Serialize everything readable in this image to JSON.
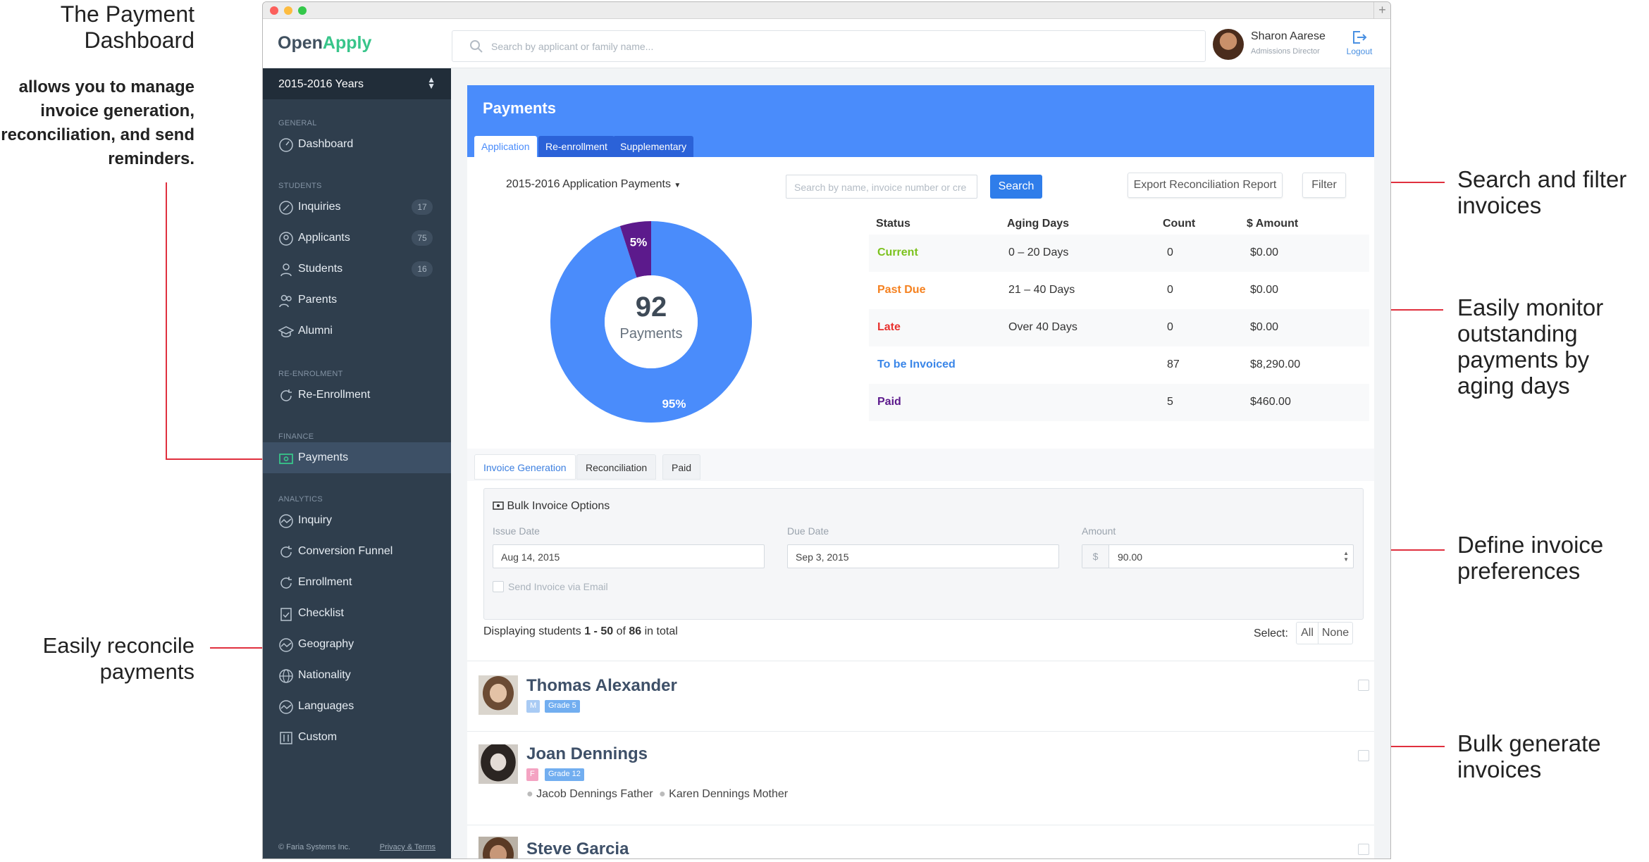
{
  "annotations": {
    "title": "The Payment Dashboard",
    "description": "allows you to manage invoice generation, reconciliation, and send reminders.",
    "search_filter": "Search and filter invoices",
    "monitor": "Easily monitor outstanding payments by aging days",
    "define": "Define invoice preferences",
    "reconcile": "Easily reconcile payments",
    "bulk": "Bulk generate invoices"
  },
  "app": {
    "logo_open": "Open",
    "logo_apply": "Apply",
    "search_placeholder": "Search by applicant or family name...",
    "user_name": "Sharon Aarese",
    "user_role": "Admissions Director",
    "logout": "Logout"
  },
  "sidebar": {
    "year": "2015-2016 Years",
    "sections": {
      "general": "GENERAL",
      "students": "STUDENTS",
      "reenrolment": "RE-ENROLMENT",
      "finance": "FINANCE",
      "analytics": "ANALYTICS"
    },
    "items": {
      "dashboard": "Dashboard",
      "inquiries": "Inquiries",
      "inquiries_count": "17",
      "applicants": "Applicants",
      "applicants_count": "75",
      "students": "Students",
      "students_count": "16",
      "parents": "Parents",
      "alumni": "Alumni",
      "reenrollment": "Re-Enrollment",
      "payments": "Payments",
      "inquiry": "Inquiry",
      "conversion_funnel": "Conversion Funnel",
      "enrollment": "Enrollment",
      "checklist": "Checklist",
      "geography": "Geography",
      "nationality": "Nationality",
      "languages": "Languages",
      "custom": "Custom"
    },
    "footer_company": "© Faria Systems Inc.",
    "footer_link": "Privacy & Terms"
  },
  "payments": {
    "title": "Payments",
    "tabs": [
      "Application",
      "Re-enrollment",
      "Supplementary"
    ],
    "dropdown": "2015-2016 Application Payments",
    "search_placeholder": "Search by name, invoice number or cre",
    "search_button": "Search",
    "export_button": "Export Reconciliation Report",
    "filter_button": "Filter",
    "donut_count": "92",
    "donut_label": "Payments",
    "donut_small_label": "5%",
    "donut_large_label": "95%",
    "donut_fraction_paid": 0.05,
    "table_headers": [
      "Status",
      "Aging Days",
      "Count",
      "$ Amount"
    ],
    "rows": [
      {
        "status": "Current",
        "aging": "0 – 20 Days",
        "count": "0",
        "amount": "$0.00",
        "color": "#7cc21e"
      },
      {
        "status": "Past Due",
        "aging": "21 – 40 Days",
        "count": "0",
        "amount": "$0.00",
        "color": "#f5811f"
      },
      {
        "status": "Late",
        "aging": "Over 40 Days",
        "count": "0",
        "amount": "$0.00",
        "color": "#e8322f"
      },
      {
        "status": "To be Invoiced",
        "aging": "",
        "count": "87",
        "amount": "$8,290.00",
        "color": "#3a86e8"
      },
      {
        "status": "Paid",
        "aging": "",
        "count": "5",
        "amount": "$460.00",
        "color": "#5c1a8c"
      }
    ],
    "subtabs": [
      "Invoice Generation",
      "Reconciliation",
      "Paid"
    ],
    "bulk_title": "Bulk Invoice Options",
    "issue_date_label": "Issue Date",
    "issue_date": "Aug 14, 2015",
    "due_date_label": "Due Date",
    "due_date": "Sep 3, 2015",
    "amount_label": "Amount",
    "amount_prefix": "$",
    "amount": "90.00",
    "send_email": "Send Invoice via Email",
    "display_prefix": "Displaying students",
    "display_range": "1 - 50",
    "display_of": "of",
    "display_total": "86",
    "display_suffix": "in total",
    "select_label": "Select:",
    "select_all": "All",
    "select_none": "None"
  },
  "students": [
    {
      "name": "Thomas Alexander",
      "gender": "M",
      "grade": "Grade 5",
      "family": []
    },
    {
      "name": "Joan Dennings",
      "gender": "F",
      "grade": "Grade 12",
      "family": [
        "Jacob Dennings Father",
        "Karen Dennings Mother"
      ]
    },
    {
      "name": "Steve Garcia",
      "gender": "",
      "grade": "",
      "family": []
    }
  ],
  "colors": {
    "brand_green": "#38c58a",
    "accent_blue": "#4a8cfb",
    "sidebar": "#2f3e4d",
    "annotation_line": "#e0303e"
  }
}
